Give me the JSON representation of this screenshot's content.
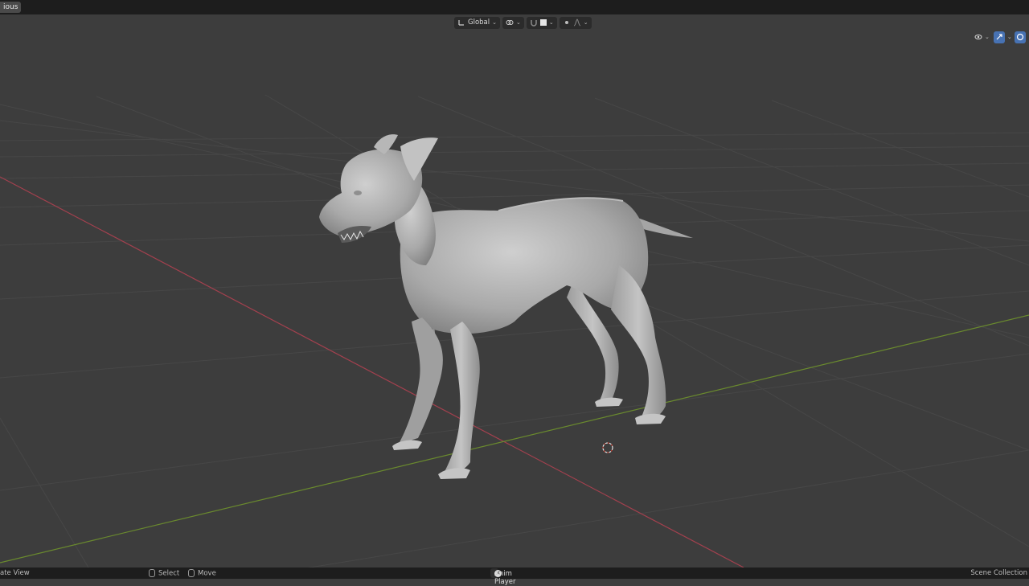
{
  "topbar": {
    "tab_label": "ious"
  },
  "header": {
    "orientation_label": "Global",
    "orientation_icon": "transform-orientation-icon",
    "pivot_icon": "link-icon",
    "snap_icon": "magnet-icon",
    "proportional_icon": "proportional-edit-icon",
    "falloff_icon": "falloff-curve-icon"
  },
  "viewport": {
    "mode": "Object Mode",
    "grid": true,
    "x_axis_color": "#a3404e",
    "y_axis_color": "#6a8a2e",
    "background": "#3d3d3d",
    "model": "dog"
  },
  "statusbar": {
    "left_text": "ate View",
    "select_label": "Select",
    "move_label": "Move",
    "center_label": "Anim Player",
    "right_text": "Scene Collection"
  }
}
